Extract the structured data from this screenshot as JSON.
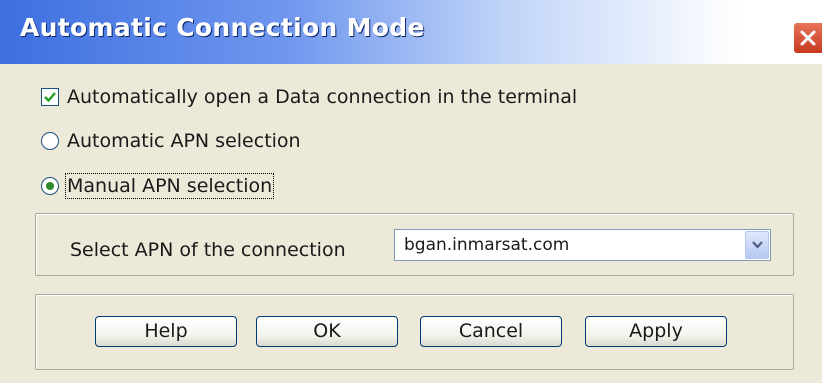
{
  "window": {
    "title": "Automatic Connection Mode",
    "close_icon": "close-icon"
  },
  "options": {
    "auto_open": {
      "label": "Automatically open a Data connection in the terminal",
      "checked": true
    },
    "apn_mode": {
      "automatic_label": "Automatic APN selection",
      "manual_label": "Manual APN selection",
      "selected": "manual"
    }
  },
  "apn": {
    "label": "Select APN of the connection",
    "selected_value": "bgan.inmarsat.com",
    "dropdown_icon": "chevron-down-icon"
  },
  "buttons": {
    "help": "Help",
    "ok": "OK",
    "cancel": "Cancel",
    "apply": "Apply"
  },
  "colors": {
    "title_bar_start": "#3d6fe0",
    "dialog_background": "#ece9d8",
    "close_button": "#d2492c"
  }
}
